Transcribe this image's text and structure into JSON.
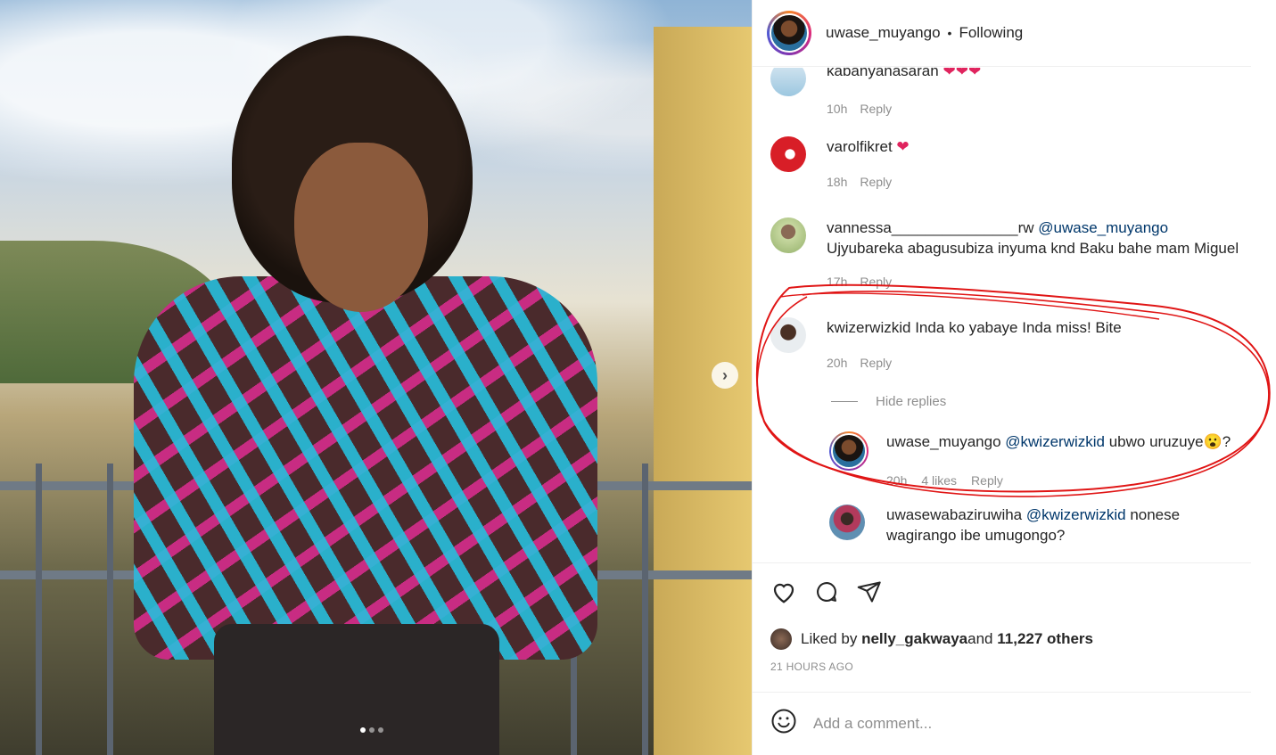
{
  "post": {
    "username": "uwase_muyango",
    "separator": "•",
    "follow_status": "Following",
    "carousel_next_icon": "chevron-right-icon"
  },
  "comments": [
    {
      "user": "kabanyanasarah",
      "text": "",
      "emoji": "❤❤❤",
      "time": "10h",
      "reply": "Reply"
    },
    {
      "user": "varolfikret",
      "text": "",
      "emoji": "❤",
      "time": "18h",
      "reply": "Reply"
    },
    {
      "user": "vannessa_______________rw",
      "mention": "@uwase_muyango",
      "text": " Ujyubareka abagusubiza inyuma knd Baku bahe mam Miguel",
      "time": "17h",
      "reply": "Reply"
    },
    {
      "user": "kwizerwizkid",
      "text": "Inda ko yabaye Inda miss! Bite",
      "time": "20h",
      "reply": "Reply"
    }
  ],
  "hide_replies": "Hide replies",
  "replies": [
    {
      "user": "uwase_muyango",
      "mention": "@kwizerwizkid",
      "text": " ubwo uruzuye",
      "emoji": "😮",
      "suffix": "?",
      "time": "20h",
      "likes": "4 likes",
      "reply": "Reply"
    },
    {
      "user": "uwasewabaziruwiha",
      "mention": "@kwizerwizkid",
      "text": " nonese wagirango ibe umugongo?"
    }
  ],
  "actions": {
    "like_icon": "heart-outline-icon",
    "comment_icon": "comment-bubble-icon",
    "share_icon": "paper-plane-icon"
  },
  "likes": {
    "prefix": "Liked by ",
    "user": "nelly_gakwaya",
    "middle": " and ",
    "count": "11,227 others"
  },
  "time_ago": "21 HOURS AGO",
  "add_comment": {
    "placeholder": "Add a comment...",
    "emoji_icon": "smile-icon"
  },
  "colors": {
    "text": "#262626",
    "secondary": "#8e8e8e",
    "mention": "#00376b",
    "annotation": "#e01515",
    "heart": "#e0245e"
  }
}
